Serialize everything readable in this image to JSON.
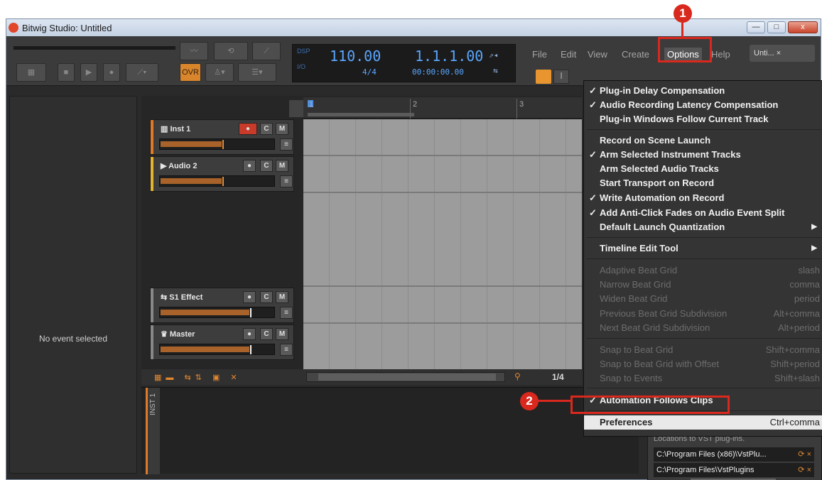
{
  "window": {
    "title": "Bitwig Studio: Untitled",
    "min_glyph": "—",
    "max_glyph": "□",
    "close_glyph": "x"
  },
  "toolbar": {
    "ovr_label": "OVR",
    "display": {
      "dsp_label": "DSP",
      "io_label": "I/O",
      "tempo": "110.00",
      "time_signature": "4/4",
      "position": "1.1.1.00",
      "time": "00:00:00.00"
    },
    "text_tool_glyph": "I"
  },
  "menubar": {
    "items": [
      "File",
      "Edit",
      "View",
      "Create",
      "Options",
      "Help"
    ],
    "project_tab": "Unti... ×"
  },
  "inspector": {
    "message": "No event selected"
  },
  "ruler": {
    "bars": [
      "1",
      "2",
      "3"
    ]
  },
  "tracks": [
    {
      "name": "Inst 1",
      "icon": "instrument-icon",
      "color": "#e07a26",
      "rec": "●",
      "solo": "C",
      "mute": "M",
      "menu": "≡"
    },
    {
      "name": "Audio 2",
      "icon": "audio-icon",
      "color": "#e6b52f",
      "rec": "●",
      "solo": "C",
      "mute": "M",
      "menu": "≡"
    },
    {
      "name": "S1 Effect",
      "icon": "effect-icon",
      "color": "#888888",
      "rec": "●",
      "solo": "C",
      "mute": "M",
      "menu": "≡"
    },
    {
      "name": "Master",
      "icon": "master-icon",
      "color": "#888888",
      "rec": "●",
      "solo": "C",
      "mute": "M",
      "menu": "≡"
    }
  ],
  "arranger_footer": {
    "zoom": "1/4"
  },
  "device_panel": {
    "tab_label": "INST 1"
  },
  "options_menu": {
    "items": [
      {
        "label": "Plug-in Delay Compensation",
        "checked": true,
        "shortcut": ""
      },
      {
        "label": "Audio Recording Latency Compensation",
        "checked": true,
        "shortcut": ""
      },
      {
        "label": "Plug-in Windows Follow Current Track",
        "checked": false,
        "shortcut": ""
      },
      {
        "label": "Record on Scene Launch",
        "checked": false,
        "shortcut": ""
      },
      {
        "label": "Arm Selected Instrument Tracks",
        "checked": true,
        "shortcut": ""
      },
      {
        "label": "Arm Selected Audio Tracks",
        "checked": false,
        "shortcut": ""
      },
      {
        "label": "Start Transport on Record",
        "checked": false,
        "shortcut": ""
      },
      {
        "label": "Write Automation on Record",
        "checked": true,
        "shortcut": ""
      },
      {
        "label": "Add Anti-Click Fades on Audio Event Split",
        "checked": true,
        "shortcut": ""
      },
      {
        "label": "Default Launch Quantization",
        "checked": false,
        "submenu": true
      },
      {
        "label": "Timeline Edit Tool",
        "checked": false,
        "submenu": true
      },
      {
        "label": "Adaptive Beat Grid",
        "disabled": true,
        "shortcut": "slash"
      },
      {
        "label": "Narrow Beat Grid",
        "disabled": true,
        "shortcut": "comma"
      },
      {
        "label": "Widen Beat Grid",
        "disabled": true,
        "shortcut": "period"
      },
      {
        "label": "Previous Beat Grid Subdivision",
        "disabled": true,
        "shortcut": "Alt+comma"
      },
      {
        "label": "Next Beat Grid Subdivision",
        "disabled": true,
        "shortcut": "Alt+period"
      },
      {
        "label": "Snap to Beat Grid",
        "disabled": true,
        "shortcut": "Shift+comma"
      },
      {
        "label": "Snap to Beat Grid with Offset",
        "disabled": true,
        "shortcut": "Shift+period"
      },
      {
        "label": "Snap to Events",
        "disabled": true,
        "shortcut": "Shift+slash"
      },
      {
        "label": "Automation Follows Clips",
        "checked": true,
        "shortcut": ""
      },
      {
        "label": "Preferences",
        "highlight": true,
        "shortcut": "Ctrl+comma"
      }
    ],
    "check_glyph": "✓",
    "submenu_glyph": "▶"
  },
  "preferences_panel": {
    "hint": "Locations to VST plug-ins.",
    "paths": [
      "C:\\Program Files (x86)\\VstPlu...",
      "C:\\Program Files\\VstPlugins"
    ],
    "action_glyphs": "⟳ ×"
  },
  "annotations": {
    "step1": "1",
    "step2": "2",
    "color": "#d9281d"
  }
}
